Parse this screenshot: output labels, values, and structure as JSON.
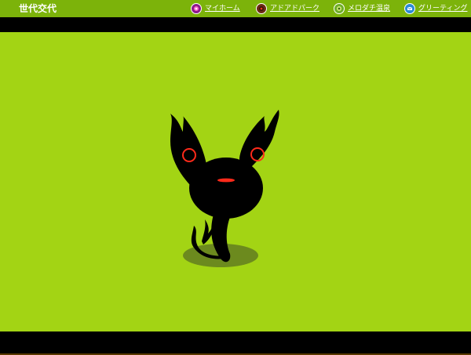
{
  "header": {
    "title": "世代交代",
    "nav": [
      {
        "label": "マイホーム",
        "icon": "home-face-icon",
        "icon_color": "#8a1a8a"
      },
      {
        "label": "アドアドパーク",
        "icon": "park-face-icon",
        "icon_color": "#6b2a14"
      },
      {
        "label": "メロダチ温泉",
        "icon": "onsen-face-icon",
        "icon_color": "#6fae2a"
      },
      {
        "label": "グリーティング",
        "icon": "greeting-icon",
        "icon_color": "#2a8ad4"
      }
    ]
  },
  "colors": {
    "header_bg": "#7cb30a",
    "stage_bg": "#a3d414",
    "band": "#000000",
    "creature": "#000000",
    "creature_accent": "#ff2a1a",
    "shadow": "#6c8a1e"
  }
}
